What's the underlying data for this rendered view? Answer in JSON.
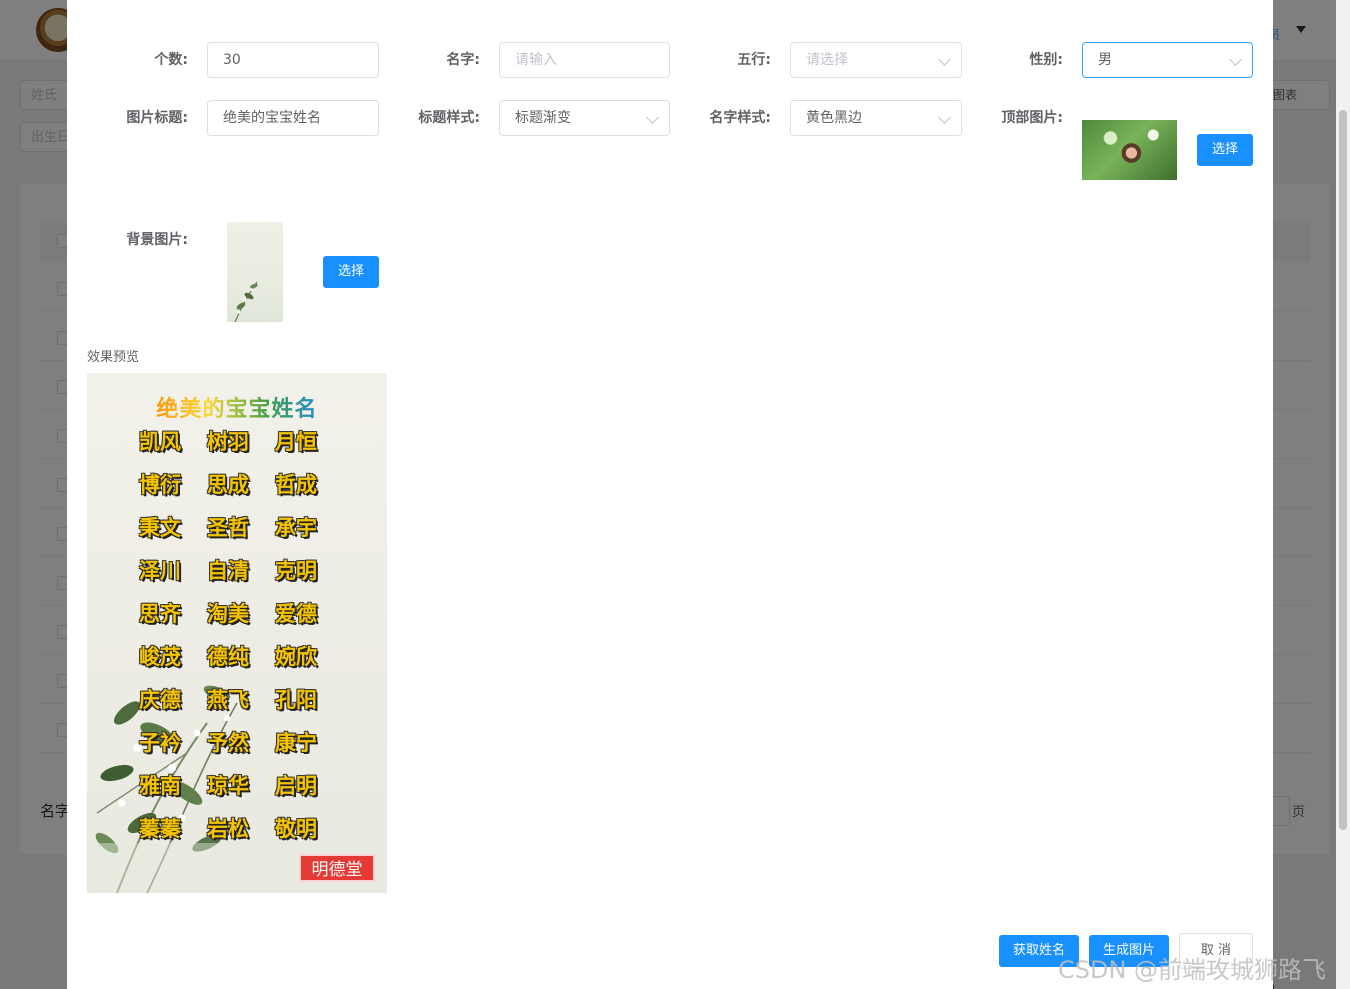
{
  "background": {
    "user_label": "员",
    "filter_surname_placeholder": "姓氏",
    "filter_birth_placeholder": "出生日",
    "view_chart_label": "看图表",
    "pager_label": "名字",
    "pager_unit": "页"
  },
  "form": {
    "count_label": "个数:",
    "count_value": "30",
    "name_label": "名字:",
    "name_placeholder": "请输入",
    "wuxing_label": "五行:",
    "wuxing_placeholder": "请选择",
    "gender_label": "性别:",
    "gender_value": "男",
    "image_title_label": "图片标题:",
    "image_title_value": "绝美的宝宝姓名",
    "title_style_label": "标题样式:",
    "title_style_value": "标题渐变",
    "name_style_label": "名字样式:",
    "name_style_value": "黄色黑边",
    "top_image_label": "顶部图片:",
    "top_image_button": "选择",
    "bg_image_label": "背景图片:",
    "bg_image_button": "选择"
  },
  "preview": {
    "label": "效果预览",
    "title": "绝美的宝宝姓名",
    "names": [
      "凯风",
      "树羽",
      "月恒",
      "博衍",
      "思成",
      "哲成",
      "秉文",
      "圣哲",
      "承宇",
      "泽川",
      "自清",
      "克明",
      "思齐",
      "淘美",
      "爱德",
      "峻茂",
      "德纯",
      "婉欣",
      "庆德",
      "燕飞",
      "孔阳",
      "子衿",
      "予然",
      "康宁",
      "雅南",
      "琼华",
      "启明",
      "蓁蓁",
      "岩松",
      "敬明"
    ],
    "seal": "明德堂"
  },
  "footer": {
    "get_names_button": "获取姓名",
    "generate_image_button": "生成图片",
    "cancel_button": "取 消"
  },
  "watermark": "CSDN @前端攻城狮路飞",
  "colors": {
    "primary": "#1890ff",
    "focus_border": "#409eff",
    "name_fill": "#f5c400",
    "seal_red": "#e53935"
  }
}
